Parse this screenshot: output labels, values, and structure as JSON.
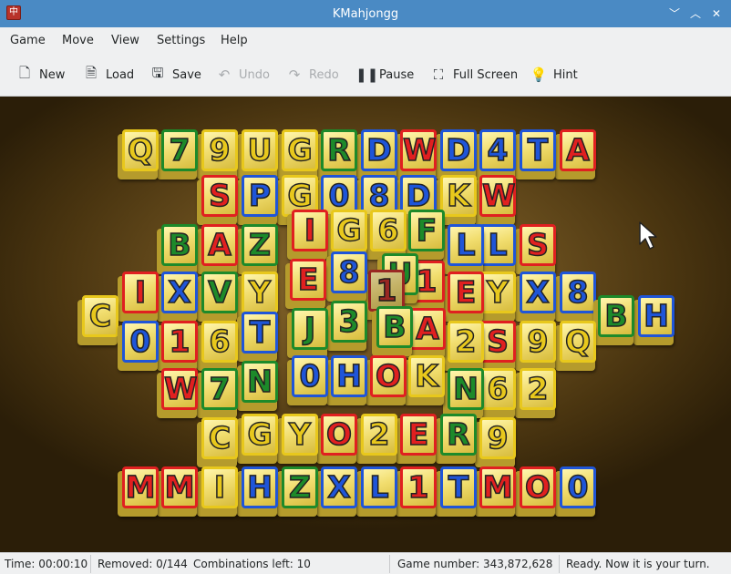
{
  "window": {
    "title": "KMahjongg",
    "app_icon": "mahjong-tile-icon",
    "controls": [
      "minimize-icon",
      "maximize-icon",
      "close-icon"
    ]
  },
  "menubar": {
    "items": [
      "Game",
      "Move",
      "View",
      "Settings",
      "Help"
    ]
  },
  "toolbar": {
    "items": [
      {
        "label": "New",
        "icon": "new-document-icon",
        "enabled": true
      },
      {
        "label": "Load",
        "icon": "load-icon",
        "enabled": true
      },
      {
        "label": "Save",
        "icon": "save-icon",
        "enabled": true
      },
      {
        "label": "Undo",
        "icon": "undo-icon",
        "enabled": false
      },
      {
        "label": "Redo",
        "icon": "redo-icon",
        "enabled": false
      },
      {
        "label": "Pause",
        "icon": "pause-icon",
        "enabled": true
      },
      {
        "label": "Full Screen",
        "icon": "fullscreen-icon",
        "enabled": true
      },
      {
        "label": "Hint",
        "icon": "hint-icon",
        "enabled": true
      }
    ]
  },
  "colors": {
    "R": "#e02020",
    "B": "#1f55d8",
    "G": "#1d8a2a",
    "Y": "#e8c81c",
    "titlebar": "#4a8ac4"
  },
  "board": {
    "tiles": [
      [
        "Q",
        "Y"
      ],
      [
        "7",
        "G"
      ],
      [
        "9",
        "Y"
      ],
      [
        "U",
        "Y"
      ],
      [
        "G",
        "Y"
      ],
      [
        "R",
        "G"
      ],
      [
        "D",
        "B"
      ],
      [
        "W",
        "R"
      ],
      [
        "D",
        "B"
      ],
      [
        "4",
        "B"
      ],
      [
        "T",
        "B"
      ],
      [
        "A",
        "R"
      ],
      [
        "S",
        "R"
      ],
      [
        "P",
        "B"
      ],
      [
        "G",
        "Y"
      ],
      [
        "0",
        "B"
      ],
      [
        "8",
        "B"
      ],
      [
        "D",
        "B"
      ],
      [
        "K",
        "Y"
      ],
      [
        "W",
        "R"
      ],
      [
        "B",
        "G"
      ],
      [
        "A",
        "R"
      ],
      [
        "Z",
        "G"
      ],
      [
        "I",
        "R"
      ],
      [
        "G",
        "Y"
      ],
      [
        "6",
        "Y"
      ],
      [
        "F",
        "G"
      ],
      [
        "L",
        "B"
      ],
      [
        "L",
        "B"
      ],
      [
        "S",
        "R"
      ],
      [
        "C",
        "Y"
      ],
      [
        "I",
        "R"
      ],
      [
        "X",
        "B"
      ],
      [
        "V",
        "G"
      ],
      [
        "Y",
        "Y"
      ],
      [
        "E",
        "R"
      ],
      [
        "8",
        "B"
      ],
      [
        "1",
        "R"
      ],
      [
        "U",
        "G"
      ],
      [
        "1",
        "R"
      ],
      [
        "E",
        "R"
      ],
      [
        "Y",
        "Y"
      ],
      [
        "X",
        "B"
      ],
      [
        "8",
        "B"
      ],
      [
        "B",
        "G"
      ],
      [
        "H",
        "B"
      ],
      [
        "0",
        "B"
      ],
      [
        "1",
        "R"
      ],
      [
        "6",
        "Y"
      ],
      [
        "T",
        "B"
      ],
      [
        "J",
        "G"
      ],
      [
        "3",
        "G"
      ],
      [
        "B",
        "G"
      ],
      [
        "A",
        "R"
      ],
      [
        "2",
        "Y"
      ],
      [
        "S",
        "R"
      ],
      [
        "9",
        "Y"
      ],
      [
        "Q",
        "Y"
      ],
      [
        "W",
        "R"
      ],
      [
        "7",
        "G"
      ],
      [
        "N",
        "G"
      ],
      [
        "0",
        "B"
      ],
      [
        "H",
        "B"
      ],
      [
        "O",
        "R"
      ],
      [
        "K",
        "Y"
      ],
      [
        "N",
        "G"
      ],
      [
        "6",
        "Y"
      ],
      [
        "2",
        "Y"
      ],
      [
        "C",
        "Y"
      ],
      [
        "G",
        "Y"
      ],
      [
        "Y",
        "Y"
      ],
      [
        "O",
        "R"
      ],
      [
        "2",
        "Y"
      ],
      [
        "E",
        "R"
      ],
      [
        "R",
        "G"
      ],
      [
        "9",
        "Y"
      ],
      [
        "M",
        "R"
      ],
      [
        "M",
        "R"
      ],
      [
        "I",
        "Y"
      ],
      [
        "H",
        "B"
      ],
      [
        "Z",
        "G"
      ],
      [
        "X",
        "B"
      ],
      [
        "L",
        "B"
      ],
      [
        "1",
        "R"
      ],
      [
        "T",
        "B"
      ],
      [
        "M",
        "R"
      ],
      [
        "O",
        "R"
      ],
      [
        "0",
        "B"
      ]
    ]
  },
  "status": {
    "time": "Time: 00:00:10",
    "removed": "Removed: 0/144",
    "combinations": "Combinations left: 10",
    "game_number": "Game number: 343,872,628",
    "message": "Ready. Now it is your turn."
  }
}
